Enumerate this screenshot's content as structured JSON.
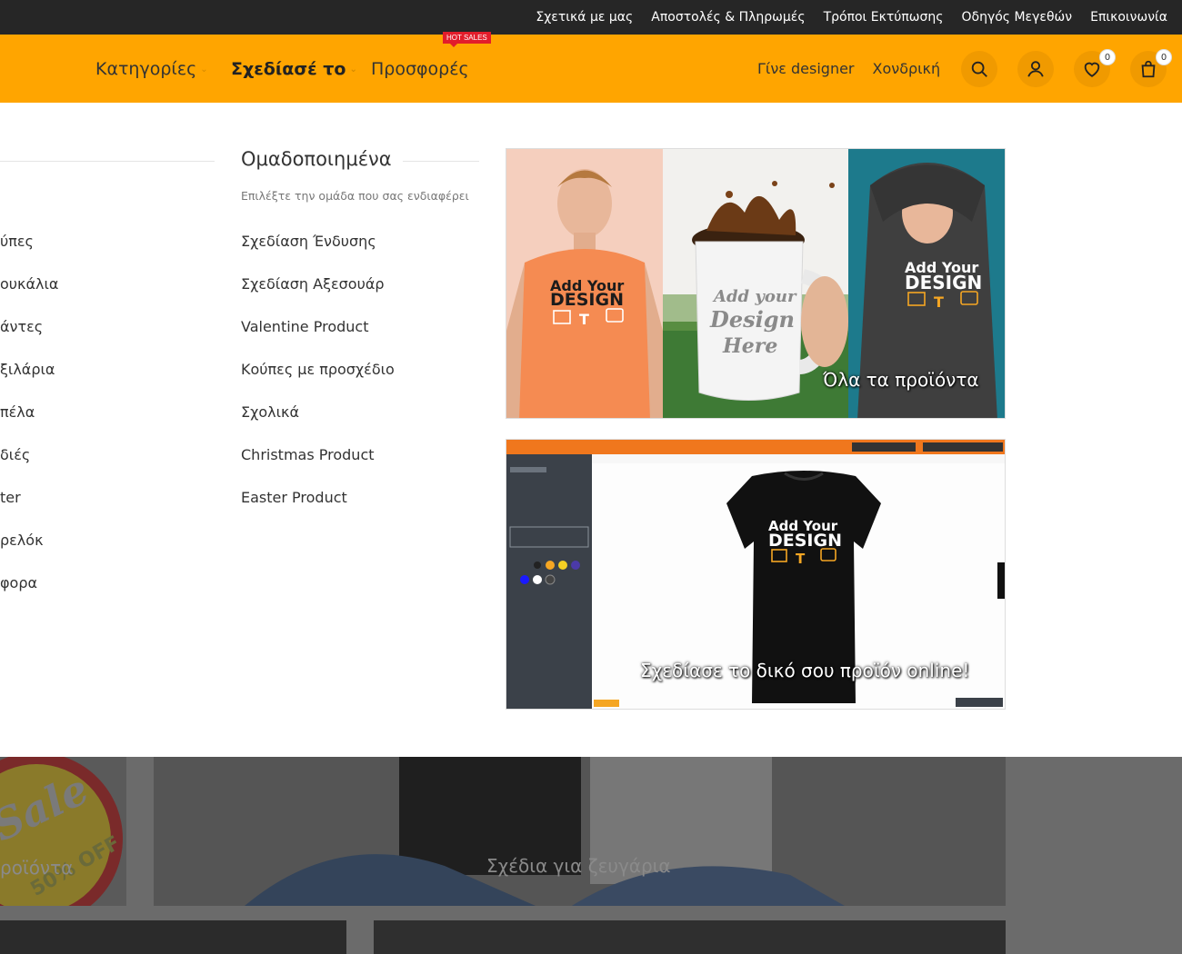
{
  "topbar": {
    "links": [
      "Σχετικά με μας",
      "Αποστολές & Πληρωμές",
      "Τρόποι Εκτύπωσης",
      "Οδηγός Μεγεθών",
      "Επικοινωνία"
    ]
  },
  "nav": {
    "categories": "Κατηγορίες",
    "design": "Σχεδίασέ το",
    "offers": "Προσφορές",
    "hot_badge": "HOT SALES"
  },
  "header_right": {
    "designer": "Γίνε designer",
    "wholesale": "Χονδρική",
    "wishlist_count": "0",
    "cart_count": "0"
  },
  "colors": {
    "topbar": "#262626",
    "accent": "#ffa500",
    "hot_badge": "#e21d2b"
  },
  "menu": {
    "left_items": [
      "ύπες",
      "ουκάλια",
      "άντες",
      "ξιλάρια",
      "πέλα",
      "διές",
      "ter",
      "ρελόκ",
      "φορα"
    ],
    "group_title": "Ομαδοποιημένα",
    "group_subtitle": "Επιλέξτε την ομάδα που σας ενδιαφέρει",
    "group_items": [
      "Σχεδίαση Ένδυσης",
      "Σχεδίαση Αξεσουάρ",
      "Valentine Product",
      "Κούπες με προσχέδιο",
      "Σχολικά",
      "Christmas Product",
      "Easter Product"
    ]
  },
  "banners": {
    "all_products": "Όλα τα προϊόντα",
    "design_online": "Σχεδίασε το δικό σου προϊόν online!",
    "tshirt_text1": "Add Your",
    "tshirt_text2": "DESIGN",
    "mug_text1": "Add your",
    "mug_text2": "Design",
    "mug_text3": "Here"
  },
  "lower": {
    "left_caption": "ροϊόντα",
    "couples_caption": "Σχέδια για ζευγάρια",
    "sale_text": "Sale",
    "off_text": "50% OFF"
  }
}
